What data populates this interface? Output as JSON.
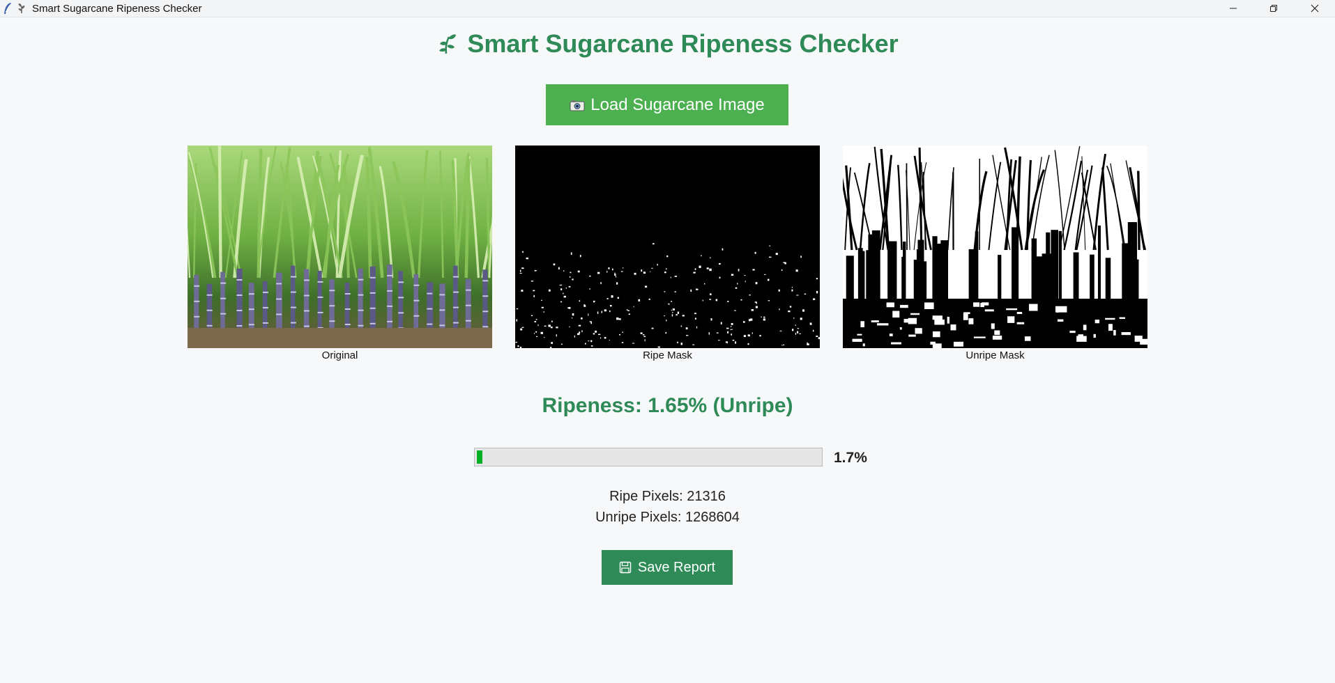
{
  "window": {
    "title": "Smart Sugarcane Ripeness Checker",
    "icons": [
      "feather-icon",
      "leaf-icon"
    ],
    "controls": [
      "minimize-icon",
      "restore-icon",
      "close-icon"
    ]
  },
  "header": {
    "title": "Smart Sugarcane Ripeness Checker",
    "icon": "leaf-icon",
    "color": "#2e8b57"
  },
  "load_button": {
    "label": "Load Sugarcane Image",
    "icon": "camera-icon",
    "color": "#4caf50"
  },
  "panels": [
    {
      "caption": "Original",
      "kind": "photo"
    },
    {
      "caption": "Ripe Mask",
      "kind": "mask"
    },
    {
      "caption": "Unripe Mask",
      "kind": "mask"
    }
  ],
  "result": {
    "ripeness_text": "Ripeness: 1.65% (Unripe)",
    "progress_percent": 1.65,
    "progress_label": "1.7%",
    "progress_color": "#06b025"
  },
  "stats": {
    "ripe_pixels": "Ripe Pixels: 21316",
    "unripe_pixels": "Unripe Pixels: 1268604"
  },
  "save_button": {
    "label": "Save Report",
    "icon": "floppy-disk-icon",
    "color": "#2e8b57"
  }
}
